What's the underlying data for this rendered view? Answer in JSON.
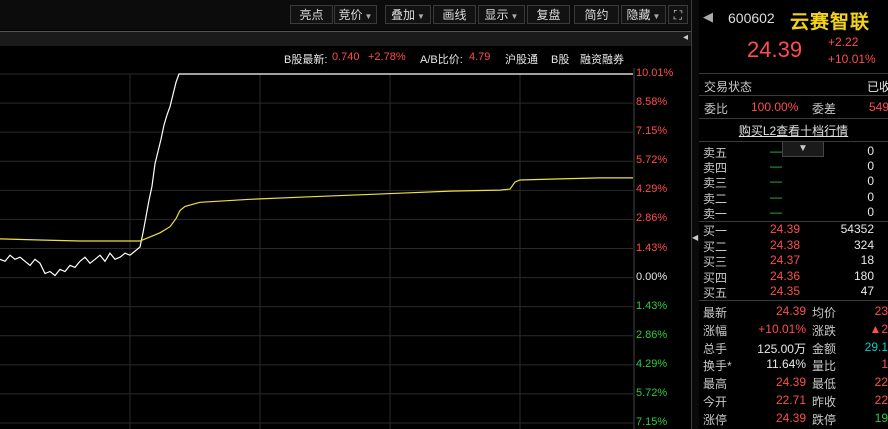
{
  "toolbar": {
    "buttons": [
      "亮点",
      "竞价",
      "叠加",
      "画线",
      "显示",
      "复盘",
      "简约",
      "隐藏"
    ],
    "expand_icon": "expand-icon"
  },
  "stock_bar": {
    "b_label": "B股最新:",
    "b_price": "0.740",
    "b_change": "+2.78%",
    "ab_label": "A/B比价:",
    "ab_value": "4.79",
    "links": [
      "沪股通",
      "B股",
      "融资融券"
    ]
  },
  "chart_data": {
    "type": "line",
    "title": "",
    "ylabel": "",
    "xlabel": "",
    "y_axis_labels": [
      "10.01%",
      "8.58%",
      "7.15%",
      "5.72%",
      "4.29%",
      "2.86%",
      "1.43%",
      "0.00%",
      "1.43%",
      "2.86%",
      "4.29%",
      "5.72%",
      "7.15%"
    ],
    "ylim": [
      -7.15,
      10.01
    ],
    "grid": true,
    "series": [
      {
        "color": "#ffffff",
        "x": [
          0,
          5,
          10,
          15,
          20,
          25,
          30,
          35,
          40,
          45,
          50,
          55,
          60,
          65,
          70,
          75,
          80,
          85,
          90,
          95,
          100,
          105,
          110,
          115,
          120,
          125,
          130,
          135,
          140,
          143,
          146,
          149,
          152,
          155,
          158,
          161,
          164,
          167,
          170,
          173,
          176,
          179,
          182,
          185,
          200,
          240,
          300,
          400,
          500,
          633
        ],
        "values": [
          0.9,
          0.8,
          1.1,
          0.9,
          1.0,
          0.8,
          0.6,
          0.9,
          0.7,
          0.2,
          0.3,
          0.1,
          0.4,
          0.3,
          0.6,
          0.5,
          0.8,
          1.0,
          0.7,
          0.9,
          1.1,
          0.8,
          1.2,
          0.9,
          1.0,
          1.2,
          1.1,
          1.3,
          1.5,
          2.2,
          3.0,
          3.8,
          4.5,
          5.6,
          6.2,
          6.8,
          7.5,
          8.0,
          8.4,
          9.0,
          9.6,
          10.01,
          10.01,
          10.01,
          10.01,
          10.01,
          10.01,
          10.01,
          10.01,
          10.01
        ]
      },
      {
        "color": "#f0e040",
        "x": [
          0,
          40,
          80,
          120,
          140,
          150,
          160,
          170,
          176,
          180,
          185,
          200,
          250,
          300,
          350,
          400,
          450,
          500,
          510,
          515,
          520,
          560,
          600,
          633
        ],
        "values": [
          1.9,
          1.85,
          1.8,
          1.8,
          1.8,
          2.0,
          2.2,
          2.5,
          2.9,
          3.3,
          3.5,
          3.7,
          3.85,
          3.95,
          4.05,
          4.15,
          4.25,
          4.3,
          4.35,
          4.7,
          4.8,
          4.85,
          4.9,
          4.9
        ]
      }
    ]
  },
  "quote": {
    "code": "600602",
    "name": "云赛智联",
    "price": "24.39",
    "change": "+2.22",
    "change_pct": "+10.01%"
  },
  "status": {
    "label": "交易状态",
    "value": "已收",
    "wb_label": "委比",
    "wb_value": "100.00%",
    "wc_label": "委差",
    "wc_value": "549"
  },
  "l2_link": "购买L2查看十档行情",
  "order_book": {
    "asks": [
      {
        "label": "卖五",
        "price": "—",
        "vol": "0"
      },
      {
        "label": "卖四",
        "price": "—",
        "vol": "0"
      },
      {
        "label": "卖三",
        "price": "—",
        "vol": "0"
      },
      {
        "label": "卖二",
        "price": "—",
        "vol": "0"
      },
      {
        "label": "卖一",
        "price": "—",
        "vol": "0"
      }
    ],
    "bids": [
      {
        "label": "买一",
        "price": "24.39",
        "vol": "54352"
      },
      {
        "label": "买二",
        "price": "24.38",
        "vol": "324"
      },
      {
        "label": "买三",
        "price": "24.37",
        "vol": "18"
      },
      {
        "label": "买四",
        "price": "24.36",
        "vol": "180"
      },
      {
        "label": "买五",
        "price": "24.35",
        "vol": "47"
      }
    ]
  },
  "stats": [
    {
      "l1": "最新",
      "v1": "24.39",
      "l2": "均价",
      "v2": "23"
    },
    {
      "l1": "涨幅",
      "v1": "+10.01%",
      "l2": "涨跌",
      "v2": "▲2"
    },
    {
      "l1": "总手",
      "v1": "125.00万",
      "l2": "金额",
      "v2": "29.1"
    },
    {
      "l1": "换手*",
      "v1": "11.64%",
      "l2": "量比",
      "v2": "1"
    },
    {
      "l1": "最高",
      "v1": "24.39",
      "l2": "最低",
      "v2": "22"
    },
    {
      "l1": "今开",
      "v1": "22.71",
      "l2": "昨收",
      "v2": "22"
    },
    {
      "l1": "涨停",
      "v1": "24.39",
      "l2": "跌停",
      "v2": "19"
    }
  ]
}
